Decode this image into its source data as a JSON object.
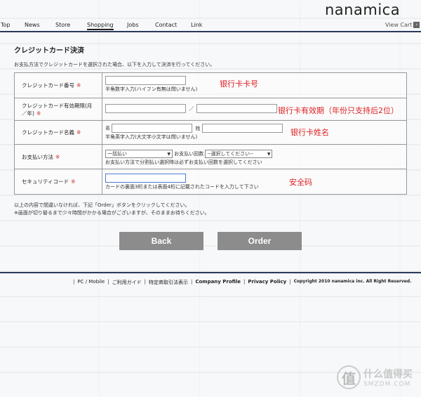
{
  "brand": {
    "logo": "nanamica"
  },
  "nav": {
    "items": [
      "Top",
      "News",
      "Store",
      "Shopping",
      "Jobs",
      "Contact",
      "Link"
    ],
    "active": "Shopping",
    "view_cart": "View Cart"
  },
  "page": {
    "title": "クレジットカード決済",
    "intro": "お支払方法でクレジットカードを選択された場合、以下を入力して決済を行ってください。"
  },
  "form": {
    "required_mark": "※",
    "card_number": {
      "label": "クレジットカード番号",
      "value": "",
      "hint": "半角数字入力(ハイフン有無は問いません)",
      "annotation": "银行卡卡号"
    },
    "expiry": {
      "label": "クレジットカード有効期限(月／年)",
      "separator": "／",
      "month_value": "",
      "year_value": "",
      "annotation": "银行卡有效期（年份只支持后2位）"
    },
    "holder": {
      "label": "クレジットカード名義",
      "first_label": "名",
      "last_label": "姓",
      "first_value": "",
      "last_value": "",
      "hint": "半角英字入力(大文字小文字は問いません)",
      "annotation": "银行卡姓名"
    },
    "payment": {
      "label": "お支払い方法",
      "method_value": "一括払い",
      "count_label": "お支払い回数",
      "count_value": "--選択してください--",
      "hint": "お支払い方法で分割払い選択時は必ずお支払い回数を選択してください"
    },
    "security": {
      "label": "セキュリティコード",
      "value": "",
      "hint": "カードの裏面3桁または表面4桁に記載されたコードを入力して下さい",
      "annotation": "安全码"
    }
  },
  "notes": {
    "line1": "以上の内容で間違いなければ、下記「Order」ボタンをクリックしてください。",
    "line2": "※画面が切り替るまで少々時間がかかる場合がございますが、そのままお待ちください。"
  },
  "buttons": {
    "back": "Back",
    "order": "Order"
  },
  "footer": {
    "links": [
      "PC / Mobile",
      "ご利用ガイド",
      "特定商取引法表示",
      "Company Profile",
      "Privacy Policy"
    ],
    "copyright": "Copyright 2010 nanamica inc. All Right Reserved."
  },
  "watermark": {
    "glyph": "值",
    "cn": "什么值得买",
    "en": "SMZDM.COM"
  },
  "colors": {
    "annotation_red": "#e02020",
    "rule_navy": "#2b3a5c",
    "button_gray": "#8c8c8c",
    "required_red": "#cc3333"
  }
}
